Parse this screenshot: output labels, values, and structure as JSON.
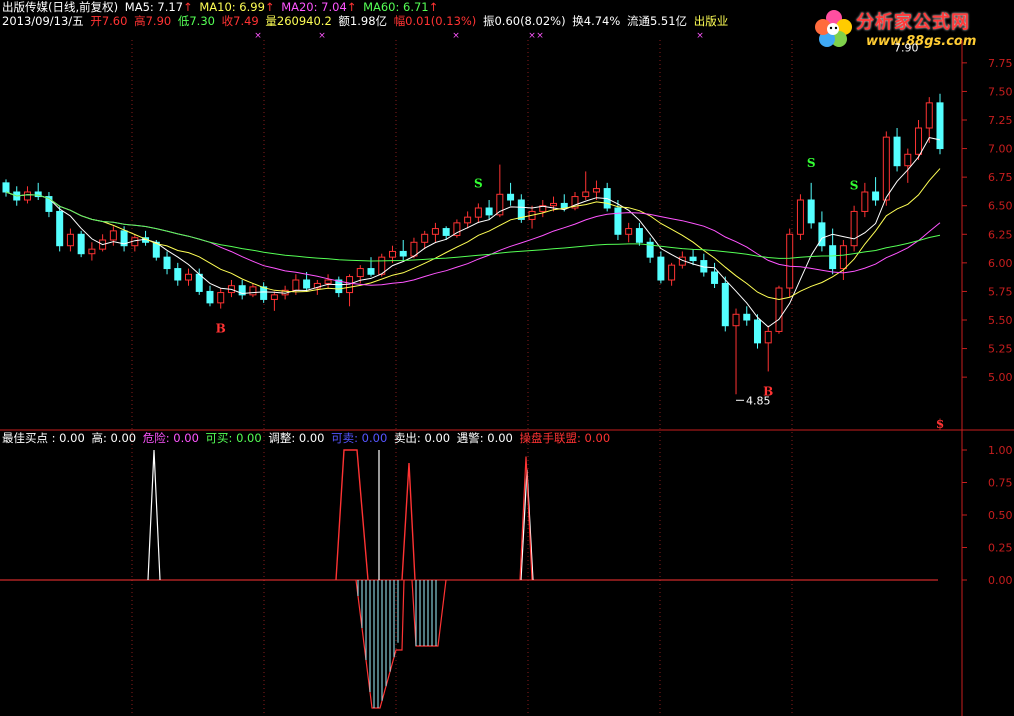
{
  "header": {
    "line1": {
      "title": "出版传媒(日线,前复权)",
      "ma5": "MA5: 7.17",
      "ma10": "MA10: 6.99",
      "ma20": "MA20: 7.04",
      "ma60": "MA60: 6.71"
    },
    "line2": {
      "date": "2013/09/13/五",
      "open": "开7.60",
      "high": "高7.90",
      "low": "低7.30",
      "close": "收7.49",
      "volume": "量260940.2",
      "amount": "额1.98亿",
      "change": "幅0.01(0.13%)",
      "amplitude": "振0.60(8.02%)",
      "turnover": "换4.74%",
      "float": "流通5.51亿",
      "industry": "出版业"
    }
  },
  "indicator_header": {
    "best_buy": "最佳买点 : 0.00",
    "high": "高: 0.00",
    "danger": "危险: 0.00",
    "can_buy": "可买: 0.00",
    "adjust": "调整: 0.00",
    "can_sell": "可卖: 0.00",
    "sell": "卖出: 0.00",
    "warn": "遇警: 0.00",
    "operator": "操盘手联盟: 0.00"
  },
  "logo": {
    "title": "分析家公式网",
    "url": "www.88gs.com"
  },
  "colors": {
    "up": "#ff3333",
    "down": "#54ffff",
    "ma5": "#ffffff",
    "ma10": "#ffff55",
    "ma20": "#ff55ff",
    "ma60": "#55ff55",
    "axis": "#c81e1e"
  },
  "chart_data": [
    {
      "type": "candlestick",
      "title": "出版传媒(日线,前复权)",
      "ylim": [
        4.8,
        7.95
      ],
      "y_ticks": [
        "7.75",
        "7.50",
        "7.25",
        "7.00",
        "6.75",
        "6.50",
        "6.25",
        "6.00",
        "5.75",
        "5.50",
        "5.25",
        "5.00"
      ],
      "annotations": {
        "high_label": "7.90",
        "low_label": "4.85"
      },
      "signals": [
        {
          "text": "S",
          "color": "#33ff33",
          "idx": 44,
          "pos": "above"
        },
        {
          "text": "B",
          "color": "#ff3333",
          "idx": 20,
          "pos": "below"
        },
        {
          "text": "B",
          "color": "#ff3333",
          "idx": 71,
          "pos": "below"
        },
        {
          "text": "S",
          "color": "#33ff33",
          "idx": 75,
          "pos": "above"
        },
        {
          "text": "S",
          "color": "#33ff33",
          "idx": 79,
          "pos": "above"
        },
        {
          "text": "$",
          "color": "#ff3333",
          "idx": 96,
          "pos": "bottom"
        }
      ],
      "candles": [
        [
          6.7,
          6.73,
          6.58,
          6.62
        ],
        [
          6.62,
          6.67,
          6.5,
          6.55
        ],
        [
          6.55,
          6.67,
          6.52,
          6.62
        ],
        [
          6.62,
          6.7,
          6.55,
          6.58
        ],
        [
          6.58,
          6.62,
          6.4,
          6.45
        ],
        [
          6.45,
          6.5,
          6.1,
          6.15
        ],
        [
          6.15,
          6.3,
          6.1,
          6.25
        ],
        [
          6.25,
          6.28,
          6.05,
          6.08
        ],
        [
          6.08,
          6.18,
          6.02,
          6.12
        ],
        [
          6.12,
          6.25,
          6.1,
          6.2
        ],
        [
          6.2,
          6.32,
          6.15,
          6.28
        ],
        [
          6.28,
          6.32,
          6.1,
          6.15
        ],
        [
          6.15,
          6.25,
          6.1,
          6.22
        ],
        [
          6.22,
          6.28,
          6.15,
          6.18
        ],
        [
          6.18,
          6.2,
          6.02,
          6.05
        ],
        [
          6.05,
          6.1,
          5.9,
          5.95
        ],
        [
          5.95,
          6.0,
          5.8,
          5.85
        ],
        [
          5.85,
          5.95,
          5.8,
          5.9
        ],
        [
          5.9,
          5.95,
          5.72,
          5.75
        ],
        [
          5.75,
          5.8,
          5.62,
          5.65
        ],
        [
          5.65,
          5.78,
          5.6,
          5.74
        ],
        [
          5.74,
          5.85,
          5.7,
          5.8
        ],
        [
          5.8,
          5.85,
          5.68,
          5.72
        ],
        [
          5.72,
          5.82,
          5.7,
          5.79
        ],
        [
          5.79,
          5.83,
          5.65,
          5.68
        ],
        [
          5.68,
          5.75,
          5.58,
          5.72
        ],
        [
          5.72,
          5.8,
          5.68,
          5.76
        ],
        [
          5.76,
          5.9,
          5.72,
          5.85
        ],
        [
          5.85,
          5.92,
          5.75,
          5.78
        ],
        [
          5.78,
          5.85,
          5.72,
          5.82
        ],
        [
          5.82,
          5.9,
          5.78,
          5.85
        ],
        [
          5.85,
          5.88,
          5.7,
          5.74
        ],
        [
          5.74,
          5.9,
          5.62,
          5.88
        ],
        [
          5.88,
          5.98,
          5.82,
          5.95
        ],
        [
          5.95,
          6.05,
          5.88,
          5.9
        ],
        [
          5.9,
          6.08,
          5.88,
          6.05
        ],
        [
          6.05,
          6.15,
          6.0,
          6.1
        ],
        [
          6.1,
          6.2,
          6.02,
          6.06
        ],
        [
          6.06,
          6.22,
          6.04,
          6.18
        ],
        [
          6.18,
          6.28,
          6.12,
          6.25
        ],
        [
          6.25,
          6.35,
          6.18,
          6.3
        ],
        [
          6.3,
          6.32,
          6.2,
          6.24
        ],
        [
          6.24,
          6.38,
          6.22,
          6.35
        ],
        [
          6.35,
          6.45,
          6.3,
          6.4
        ],
        [
          6.4,
          6.52,
          6.35,
          6.48
        ],
        [
          6.48,
          6.55,
          6.38,
          6.42
        ],
        [
          6.42,
          6.86,
          6.4,
          6.6
        ],
        [
          6.6,
          6.7,
          6.5,
          6.55
        ],
        [
          6.55,
          6.6,
          6.35,
          6.38
        ],
        [
          6.38,
          6.5,
          6.3,
          6.45
        ],
        [
          6.45,
          6.55,
          6.4,
          6.5
        ],
        [
          6.5,
          6.58,
          6.45,
          6.52
        ],
        [
          6.52,
          6.6,
          6.45,
          6.48
        ],
        [
          6.48,
          6.62,
          6.46,
          6.58
        ],
        [
          6.58,
          6.8,
          6.55,
          6.62
        ],
        [
          6.62,
          6.72,
          6.55,
          6.65
        ],
        [
          6.65,
          6.7,
          6.45,
          6.48
        ],
        [
          6.48,
          6.55,
          6.2,
          6.25
        ],
        [
          6.25,
          6.35,
          6.18,
          6.3
        ],
        [
          6.3,
          6.35,
          6.15,
          6.18
        ],
        [
          6.18,
          6.22,
          6.0,
          6.05
        ],
        [
          6.05,
          6.1,
          5.82,
          5.85
        ],
        [
          5.85,
          6.0,
          5.8,
          5.98
        ],
        [
          5.98,
          6.1,
          5.95,
          6.05
        ],
        [
          6.05,
          6.12,
          5.98,
          6.02
        ],
        [
          6.02,
          6.08,
          5.88,
          5.92
        ],
        [
          5.92,
          6.0,
          5.78,
          5.82
        ],
        [
          5.82,
          5.88,
          5.4,
          5.45
        ],
        [
          5.45,
          5.6,
          4.85,
          5.55
        ],
        [
          5.55,
          5.62,
          5.45,
          5.5
        ],
        [
          5.5,
          5.55,
          5.25,
          5.3
        ],
        [
          5.3,
          5.45,
          5.05,
          5.4
        ],
        [
          5.4,
          5.8,
          5.38,
          5.78
        ],
        [
          5.78,
          6.3,
          5.7,
          6.25
        ],
        [
          6.25,
          6.6,
          6.2,
          6.55
        ],
        [
          6.55,
          6.7,
          6.3,
          6.35
        ],
        [
          6.35,
          6.45,
          6.1,
          6.15
        ],
        [
          6.15,
          6.3,
          5.9,
          5.95
        ],
        [
          5.95,
          6.2,
          5.85,
          6.15
        ],
        [
          6.15,
          6.5,
          6.1,
          6.45
        ],
        [
          6.45,
          6.7,
          6.4,
          6.62
        ],
        [
          6.62,
          6.75,
          6.5,
          6.55
        ],
        [
          6.55,
          7.15,
          6.5,
          7.1
        ],
        [
          7.1,
          7.18,
          6.8,
          6.85
        ],
        [
          6.85,
          7.0,
          6.7,
          6.95
        ],
        [
          6.95,
          7.25,
          6.9,
          7.18
        ],
        [
          7.18,
          7.45,
          7.05,
          7.4
        ],
        [
          7.4,
          7.48,
          6.95,
          7.0
        ]
      ]
    },
    {
      "type": "line",
      "title": "最佳买点",
      "ylim": [
        -1.1,
        1.1
      ],
      "y_ticks": [
        "1.00",
        "0.75",
        "0.50",
        "0.25",
        "0.00"
      ]
    }
  ]
}
